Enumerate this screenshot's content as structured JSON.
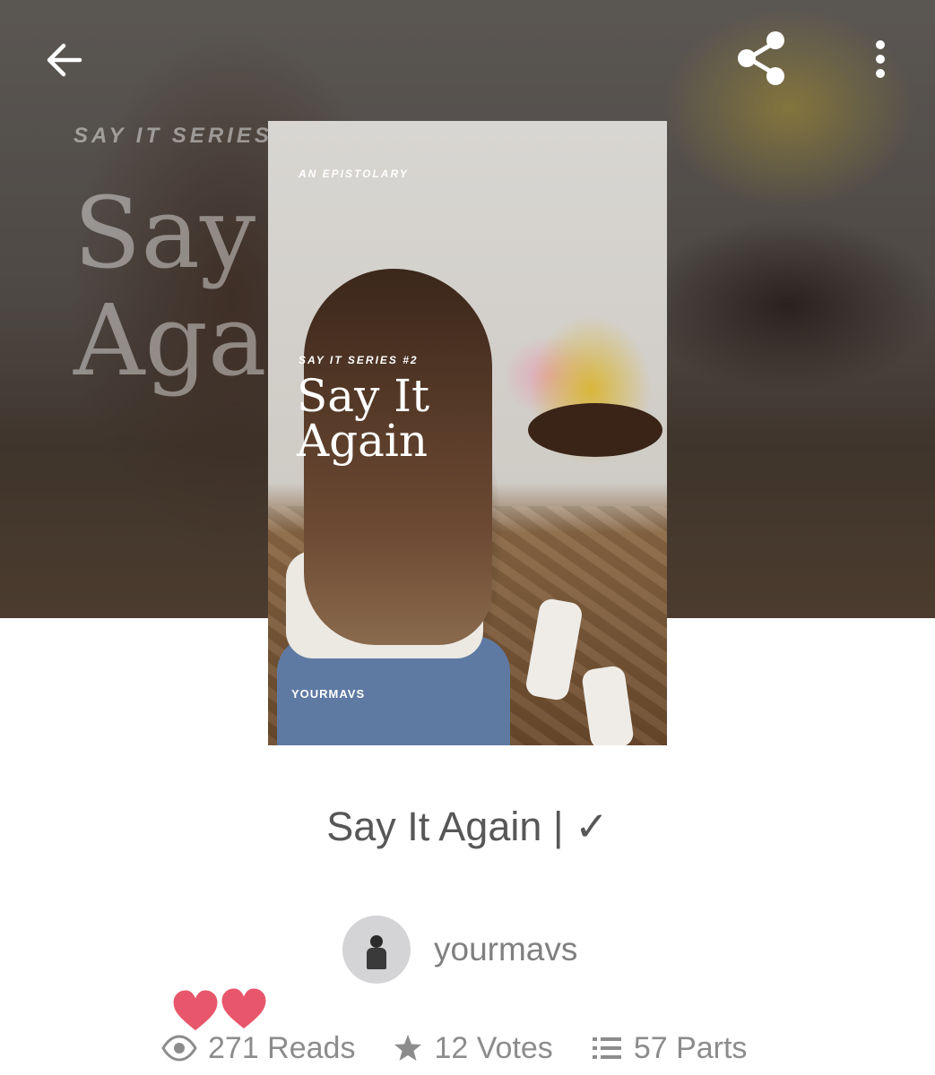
{
  "hero": {
    "ghost_series": "SAY IT SERIES",
    "ghost_title_line1": "Say",
    "ghost_title_line2": "Aga"
  },
  "toolbar": {
    "back_icon": "arrow-left-icon",
    "share_icon": "share-icon",
    "more_icon": "more-vertical-icon"
  },
  "cover": {
    "kicker": "AN EPISTOLARY",
    "series": "SAY IT SERIES #2",
    "title": "Say It Again",
    "author": "YOURMAVS"
  },
  "story": {
    "title": "Say It Again  | ✓",
    "author": "yourmavs"
  },
  "stats": {
    "reads": "271 Reads",
    "votes": "12 Votes",
    "parts": "57 Parts"
  },
  "colors": {
    "text": "#575757",
    "muted": "#8c8c8c",
    "heart": "#e8566b"
  }
}
